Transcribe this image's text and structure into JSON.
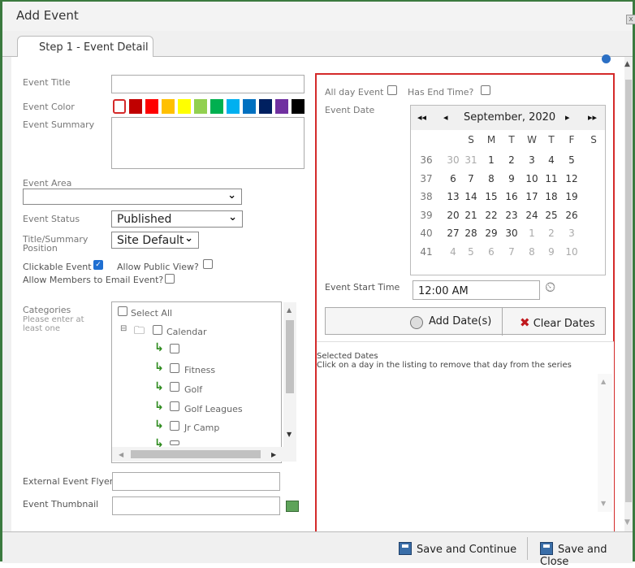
{
  "window": {
    "title": "Add Event",
    "close_icon": "x-icon"
  },
  "tab": {
    "label": "Step 1 - Event Detail"
  },
  "form": {
    "event_title_label": "Event Title",
    "event_color_label": "Event Color",
    "event_summary_label": "Event Summary",
    "event_area_label": "Event Area",
    "event_area_value": "",
    "event_status_label": "Event Status",
    "event_status_value": "Published",
    "title_position_label_1": "Title/Summary",
    "title_position_label_2": "Position",
    "title_position_value": "Site Default",
    "clickable_event_label": "Clickable Event",
    "allow_public_view_label": "Allow Public View?",
    "allow_members_email_label": "Allow Members to Email Event?",
    "categories_label": "Categories",
    "categories_hint_1": "Please enter at",
    "categories_hint_2": "least one",
    "external_flyer_label": "External Event Flyer",
    "event_thumbnail_label": "Event Thumbnail"
  },
  "colors": [
    "#ffffff",
    "#c00000",
    "#ff0000",
    "#ffc000",
    "#ffff00",
    "#92d050",
    "#00b050",
    "#00b0f0",
    "#0070c0",
    "#002060",
    "#7030a0",
    "#000000"
  ],
  "categories": {
    "select_all": "Select All",
    "items": [
      "Calendar",
      "",
      "Fitness",
      "Golf",
      "Golf Leagues",
      "Jr Camp"
    ]
  },
  "schedule": {
    "all_day_label": "All day Event",
    "has_end_time_label": "Has End Time?",
    "event_date_label": "Event Date",
    "start_time_label": "Event Start Time",
    "start_time_value": "12:00 AM",
    "add_dates_label": "Add Date(s)",
    "clear_dates_label": "Clear Dates",
    "selected_dates_title": "Selected Dates",
    "selected_dates_hint": "Click on a day in the listing to remove that day from the series"
  },
  "calendar": {
    "month": "September, 2020",
    "prev_year": "◂◂",
    "prev_month": "◂",
    "next_month": "▸",
    "next_year": "▸▸",
    "days": [
      "S",
      "M",
      "T",
      "W",
      "T",
      "F",
      "S"
    ],
    "weeks": [
      {
        "wk": "36",
        "d": [
          [
            "30",
            0
          ],
          [
            "31",
            0
          ],
          [
            "1",
            1
          ],
          [
            "2",
            1
          ],
          [
            "3",
            1
          ],
          [
            "4",
            1
          ],
          [
            "5",
            1
          ]
        ]
      },
      {
        "wk": "37",
        "d": [
          [
            "6",
            1
          ],
          [
            "7",
            1
          ],
          [
            "8",
            1
          ],
          [
            "9",
            1
          ],
          [
            "10",
            1
          ],
          [
            "11",
            1
          ],
          [
            "12",
            1
          ]
        ]
      },
      {
        "wk": "38",
        "d": [
          [
            "13",
            1
          ],
          [
            "14",
            1
          ],
          [
            "15",
            1
          ],
          [
            "16",
            1
          ],
          [
            "17",
            1
          ],
          [
            "18",
            1
          ],
          [
            "19",
            1
          ]
        ]
      },
      {
        "wk": "39",
        "d": [
          [
            "20",
            1
          ],
          [
            "21",
            1
          ],
          [
            "22",
            1
          ],
          [
            "23",
            1
          ],
          [
            "24",
            1
          ],
          [
            "25",
            1
          ],
          [
            "26",
            1
          ]
        ]
      },
      {
        "wk": "40",
        "d": [
          [
            "27",
            1
          ],
          [
            "28",
            1
          ],
          [
            "29",
            1
          ],
          [
            "30",
            1
          ],
          [
            "1",
            0
          ],
          [
            "2",
            0
          ],
          [
            "3",
            0
          ]
        ]
      },
      {
        "wk": "41",
        "d": [
          [
            "4",
            0
          ],
          [
            "5",
            0
          ],
          [
            "6",
            0
          ],
          [
            "7",
            0
          ],
          [
            "8",
            0
          ],
          [
            "9",
            0
          ],
          [
            "10",
            0
          ]
        ]
      }
    ]
  },
  "footer": {
    "save_continue": "Save and Continue",
    "save_close": "Save and Close"
  }
}
